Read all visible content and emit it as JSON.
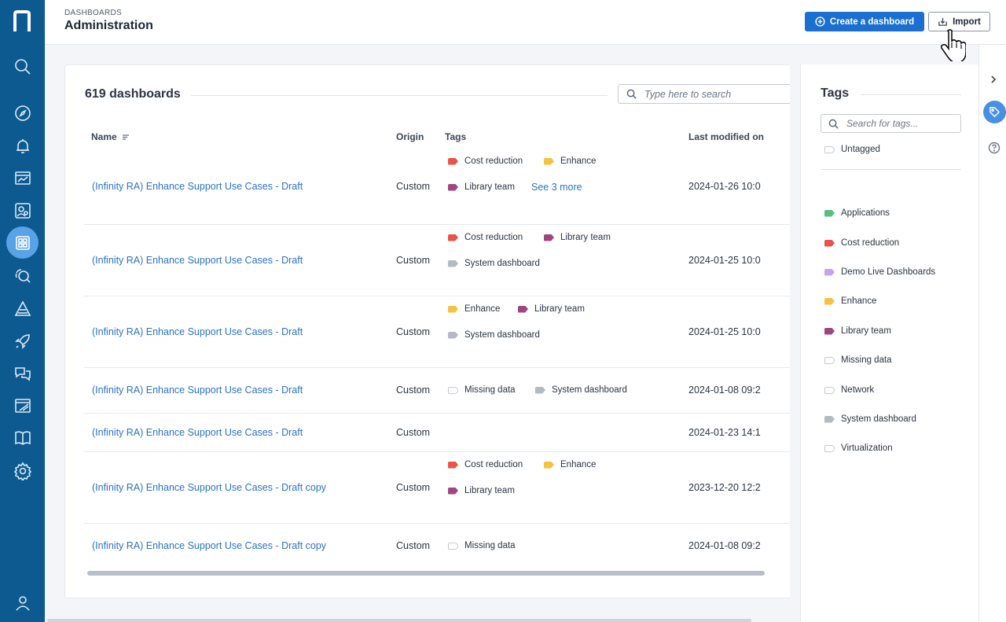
{
  "header": {
    "breadcrumb": "DASHBOARDS",
    "title": "Administration",
    "create_label": "Create a dashboard",
    "import_label": "Import"
  },
  "nav": {
    "items": [
      "search-icon",
      "compass-icon",
      "bell-icon",
      "monitor-chart-icon",
      "users-search-icon",
      "dashboards-icon",
      "investigate-icon",
      "hazard-icon",
      "rocket-icon",
      "chat-icon",
      "report-icon",
      "book-icon",
      "gear-icon"
    ],
    "active": "dashboards-icon",
    "profile": "user-icon"
  },
  "main": {
    "count_label": "619 dashboards",
    "search_placeholder": "Type here to search",
    "columns": {
      "name": "Name",
      "origin": "Origin",
      "tags": "Tags",
      "modified": "Last modified on"
    },
    "rows": [
      {
        "name": "(Infinity RA) Enhance Support Use Cases - Draft",
        "origin": "Custom",
        "date": "2024-01-26 10:0",
        "tags": [
          "Cost reduction",
          "Enhance",
          "Library team"
        ],
        "more": "See 3 more"
      },
      {
        "name": "(Infinity RA) Enhance Support Use Cases - Draft",
        "origin": "Custom",
        "date": "2024-01-25 10:0",
        "tags": [
          "Cost reduction",
          "Library team",
          "System dashboard"
        ],
        "more": ""
      },
      {
        "name": "(Infinity RA) Enhance Support Use Cases - Draft",
        "origin": "Custom",
        "date": "2024-01-25 10:0",
        "tags": [
          "Enhance",
          "Library team",
          "System dashboard"
        ],
        "more": ""
      },
      {
        "name": "(Infinity RA) Enhance Support Use Cases - Draft",
        "origin": "Custom",
        "date": "2024-01-08 09:2",
        "tags": [
          "Missing data",
          "System dashboard"
        ],
        "more": ""
      },
      {
        "name": "(Infinity RA) Enhance Support Use Cases - Draft",
        "origin": "Custom",
        "date": "2024-01-23 14:1",
        "tags": [],
        "more": ""
      },
      {
        "name": "(Infinity RA) Enhance Support Use Cases - Draft copy",
        "origin": "Custom",
        "date": "2023-12-20 12:2",
        "tags": [
          "Cost reduction",
          "Enhance",
          "Library team"
        ],
        "more": ""
      },
      {
        "name": "(Infinity RA) Enhance Support Use Cases - Draft copy",
        "origin": "Custom",
        "date": "2024-01-08 09:2",
        "tags": [
          "Missing data"
        ],
        "more": ""
      }
    ]
  },
  "tags_panel": {
    "title": "Tags",
    "search_placeholder": "Search for tags...",
    "untagged": "Untagged",
    "items": [
      "Applications",
      "Cost reduction",
      "Demo Live Dashboards",
      "Enhance",
      "Library team",
      "Missing data",
      "Network",
      "System dashboard",
      "Virtualization"
    ]
  },
  "tag_colors": {
    "Applications": "#5cbf7f",
    "Cost reduction": "#e8534a",
    "Demo Live Dashboards": "#c9a2ee",
    "Enhance": "#f7c244",
    "Library team": "#a0467e",
    "Missing data": "outline",
    "Network": "outline",
    "System dashboard": "#b4b9c4",
    "Virtualization": "outline",
    "Untagged": "outline"
  },
  "colors": {
    "nav_bg": "#0c5a8f",
    "accent": "#1b6fd1",
    "link": "#2a73c9"
  }
}
